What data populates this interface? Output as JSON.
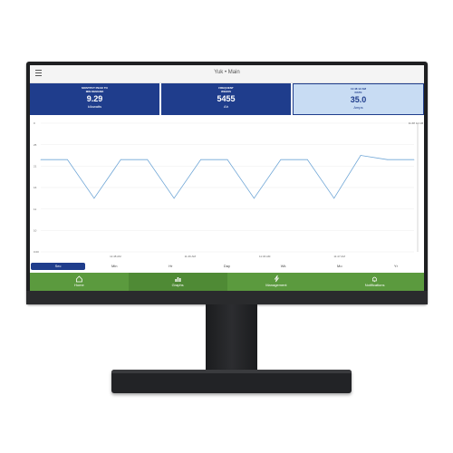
{
  "app": {
    "title": "Yuk • Main"
  },
  "cards": [
    {
      "label_line1": "MOSTPCT PEAK TO",
      "label_line2": "MIN DEMAND",
      "value": "9.29",
      "unit": "kilowatts"
    },
    {
      "label_line1": "FREQUENT",
      "label_line2": "WEEKS",
      "value": "5455",
      "unit": "Ah"
    },
    {
      "label_line1": "11:48 12 AM",
      "label_line2": "RATE",
      "value": "35.0",
      "unit": "Amps"
    }
  ],
  "chart_data": {
    "type": "line",
    "yticks": [
      "0",
      "25",
      "21",
      "16",
      "11",
      "10",
      "0.00"
    ],
    "xticks": [
      "11:48 AM",
      "11:46 AM",
      "11:46 AM",
      "11:47 AM"
    ],
    "cursor_label": "11:48 12 AM",
    "series": [
      {
        "values": [
          21.5,
          21.5,
          12.5,
          21.5,
          21.5,
          12.5,
          21.5,
          21.5,
          12.5,
          21.5,
          21.5,
          12.5,
          22.5,
          21.5,
          21.5
        ]
      }
    ],
    "grid": true
  },
  "time_tabs": [
    "Sec",
    "Min",
    "Hr",
    "Day",
    "Wk",
    "Mo",
    "Yr"
  ],
  "selected_tab": "Sec",
  "nav": [
    {
      "label": "Home",
      "icon": "home-icon"
    },
    {
      "label": "Graphs",
      "icon": "bar-chart-icon"
    },
    {
      "label": "Management",
      "icon": "lightning-icon"
    },
    {
      "label": "Notifications",
      "icon": "bell-icon"
    }
  ],
  "colors": {
    "primary": "#1f3d8c",
    "nav": "#5b9a3e",
    "line": "#6fa6d6",
    "bezel": "#1e1f21"
  }
}
